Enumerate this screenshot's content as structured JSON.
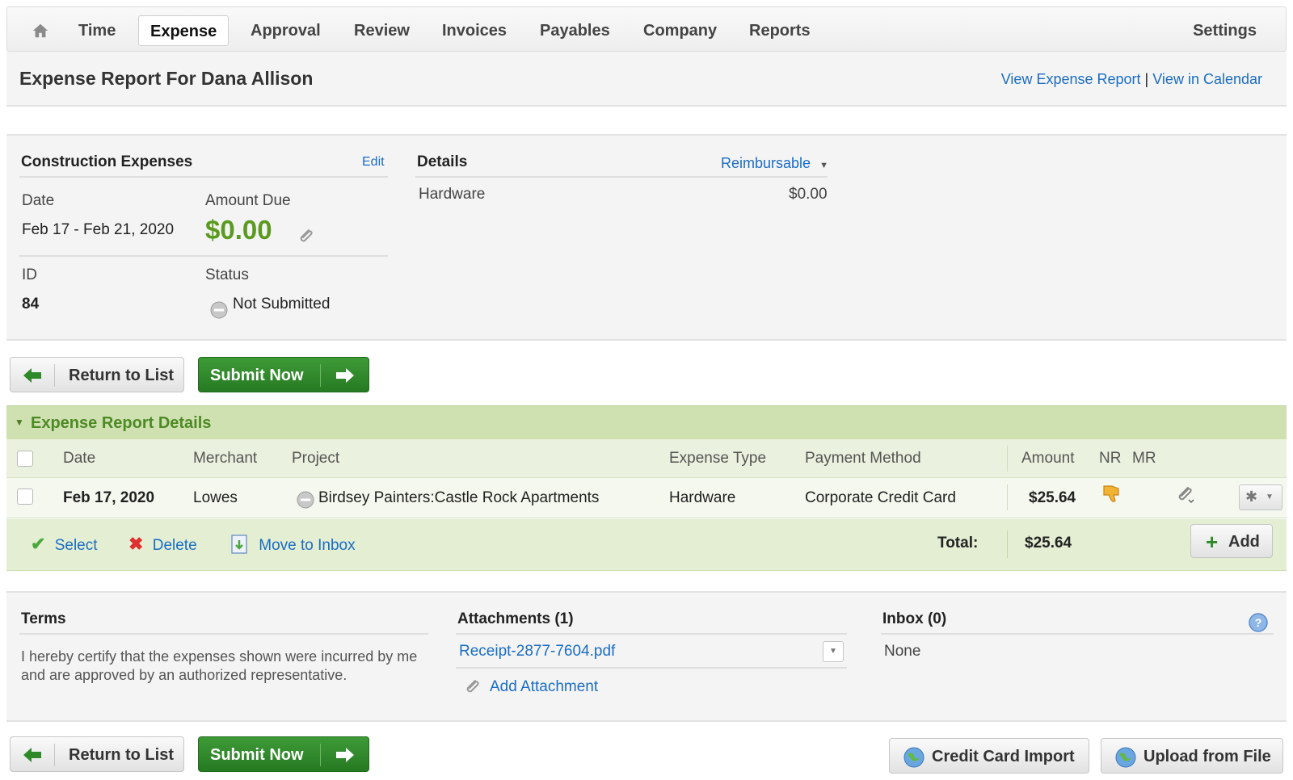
{
  "nav": {
    "items": [
      "Time",
      "Expense",
      "Approval",
      "Review",
      "Invoices",
      "Payables",
      "Company",
      "Reports"
    ],
    "settings": "Settings"
  },
  "header": {
    "title": "Expense Report For Dana Allison",
    "view_report": "View Expense Report",
    "separator": "|",
    "view_calendar": "View in Calendar"
  },
  "summary": {
    "name": "Construction Expenses",
    "edit": "Edit",
    "date_label": "Date",
    "date_value": "Feb 17 - Feb 21, 2020",
    "amount_label": "Amount Due",
    "amount_value": "$0.00",
    "id_label": "ID",
    "id_value": "84",
    "status_label": "Status",
    "status_value": "Not Submitted",
    "details_label": "Details",
    "reimbursable": "Reimbursable",
    "detail_item": "Hardware",
    "detail_amount": "$0.00"
  },
  "actions": {
    "return": "Return to List",
    "submit": "Submit Now"
  },
  "details_section": {
    "title": "Expense Report Details",
    "columns": {
      "date": "Date",
      "merchant": "Merchant",
      "project": "Project",
      "expense_type": "Expense Type",
      "payment_method": "Payment Method",
      "amount": "Amount",
      "nr": "NR",
      "mr": "MR"
    },
    "rows": [
      {
        "date": "Feb 17, 2020",
        "merchant": "Lowes",
        "project": "Birdsey Painters:Castle Rock Apartments",
        "expense_type": "Hardware",
        "payment_method": "Corporate Credit Card",
        "amount": "$25.64"
      }
    ],
    "footer": {
      "select": "Select",
      "delete": "Delete",
      "move_inbox": "Move to Inbox",
      "total_label": "Total:",
      "total_value": "$25.64",
      "add": "Add"
    }
  },
  "bottom": {
    "terms_title": "Terms",
    "terms_text": "I hereby certify that the expenses shown were incurred by me and are approved by an authorized representative.",
    "attachments_title": "Attachments (1)",
    "attachment_file": "Receipt-2877-7604.pdf",
    "add_attachment": "Add Attachment",
    "inbox_title": "Inbox (0)",
    "inbox_value": "None"
  },
  "bottom_actions": {
    "credit_card_import": "Credit Card Import",
    "upload_from_file": "Upload from File"
  },
  "colors": {
    "green_amount": "#5a9a1e",
    "link": "#1a6dc4",
    "section_green": "#cfe1b0",
    "button_green": "#2e8a29"
  }
}
